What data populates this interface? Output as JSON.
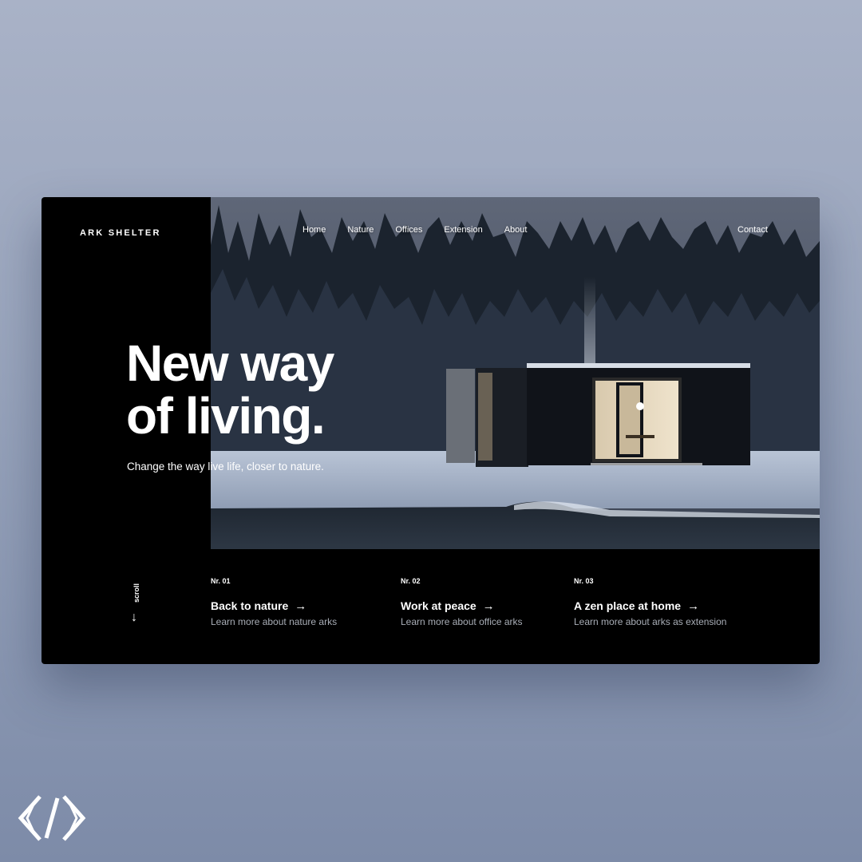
{
  "brand": "ARK SHELTER",
  "nav": {
    "items": [
      "Home",
      "Nature",
      "Offices",
      "Extension",
      "About"
    ],
    "contact": "Contact"
  },
  "hero": {
    "headline_line1": "New way",
    "headline_line2": "of living.",
    "tagline": "Change the way live life, closer to nature."
  },
  "scroll": {
    "label": "scroll",
    "arrow": "↓"
  },
  "features": [
    {
      "number": "Nr. 01",
      "title": "Back to nature",
      "arrow": "→",
      "subtitle": "Learn more about nature arks"
    },
    {
      "number": "Nr. 02",
      "title": "Work at peace",
      "arrow": "→",
      "subtitle": "Learn more about office arks"
    },
    {
      "number": "Nr. 03",
      "title": "A zen place at home",
      "arrow": "→",
      "subtitle": "Learn more about arks as extension"
    }
  ],
  "colors": {
    "page_background": "#97a3bb",
    "card_background": "#000000",
    "text_primary": "#ffffff",
    "text_secondary": "#a8adb6"
  },
  "icons": {
    "scroll": "arrow-down-icon",
    "feature_link": "arrow-right-icon",
    "corner_logo": "chevron-slash-logo"
  }
}
